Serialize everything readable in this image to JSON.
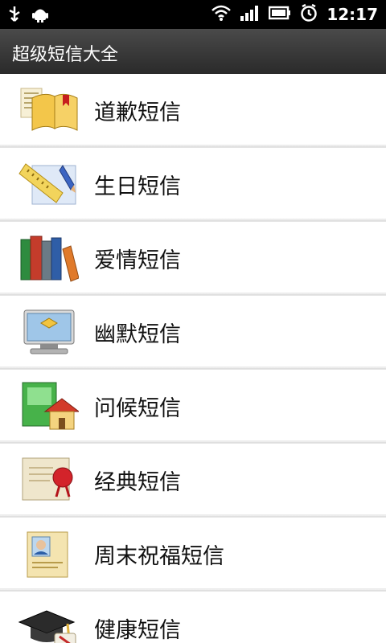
{
  "status_bar": {
    "time": "12:17"
  },
  "app": {
    "title": "超级短信大全"
  },
  "list_items": [
    {
      "label": "道歉短信",
      "icon": "book-icon"
    },
    {
      "label": "生日短信",
      "icon": "ruler-pencil-icon"
    },
    {
      "label": "爱情短信",
      "icon": "books-icon"
    },
    {
      "label": "幽默短信",
      "icon": "monitor-icon"
    },
    {
      "label": "问候短信",
      "icon": "book-house-icon"
    },
    {
      "label": "经典短信",
      "icon": "certificate-seal-icon"
    },
    {
      "label": "周末祝福短信",
      "icon": "id-card-icon"
    },
    {
      "label": "健康短信",
      "icon": "graduation-cap-icon"
    }
  ],
  "colors": {
    "status_bar_bg": "#000000",
    "title_bar_bg": "#333333",
    "list_bg": "#ffffff"
  }
}
